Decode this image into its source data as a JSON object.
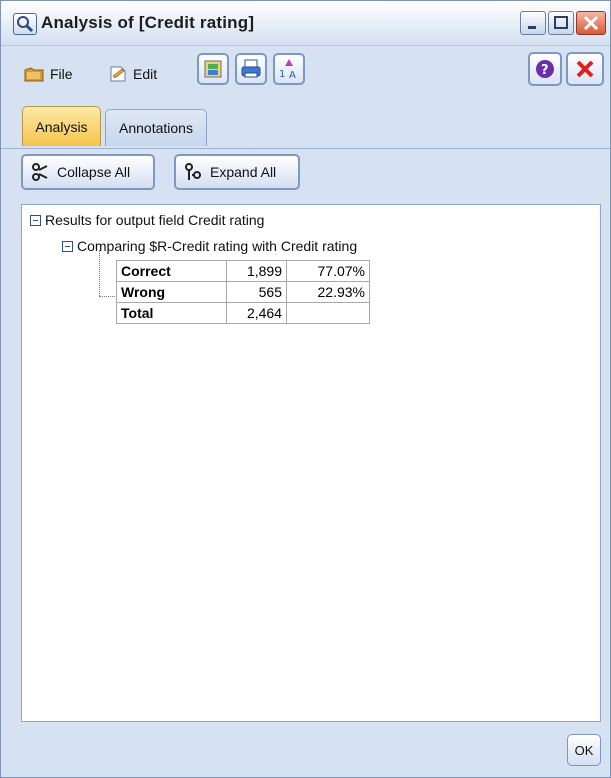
{
  "window": {
    "title": "Analysis of [Credit rating]"
  },
  "toolbar": {
    "file_label": "File",
    "edit_label": "Edit"
  },
  "tabs": [
    {
      "label": "Analysis"
    },
    {
      "label": "Annotations"
    }
  ],
  "actions": {
    "collapse_label": "Collapse All",
    "expand_label": "Expand All"
  },
  "tree": {
    "root_label": "Results for output field Credit rating",
    "child_label": "Comparing $R-Credit rating with Credit rating",
    "table": [
      {
        "label": "Correct",
        "count": "1,899",
        "pct": "77.07%"
      },
      {
        "label": "Wrong",
        "count": "565",
        "pct": "22.93%"
      },
      {
        "label": "Total",
        "count": "2,464",
        "pct": ""
      }
    ]
  },
  "footer": {
    "ok_label": "OK"
  },
  "colors": {
    "active_tab": "#f5c44c",
    "window_bg": "#d6e2f2",
    "close_red": "#d9593b"
  },
  "icons": [
    "search-icon",
    "minimize-icon",
    "maximize-icon",
    "close-icon",
    "file-icon",
    "edit-icon",
    "export-icon",
    "print-icon",
    "sort-icon",
    "help-icon",
    "close-tool-icon",
    "collapse-icon",
    "expand-icon"
  ]
}
